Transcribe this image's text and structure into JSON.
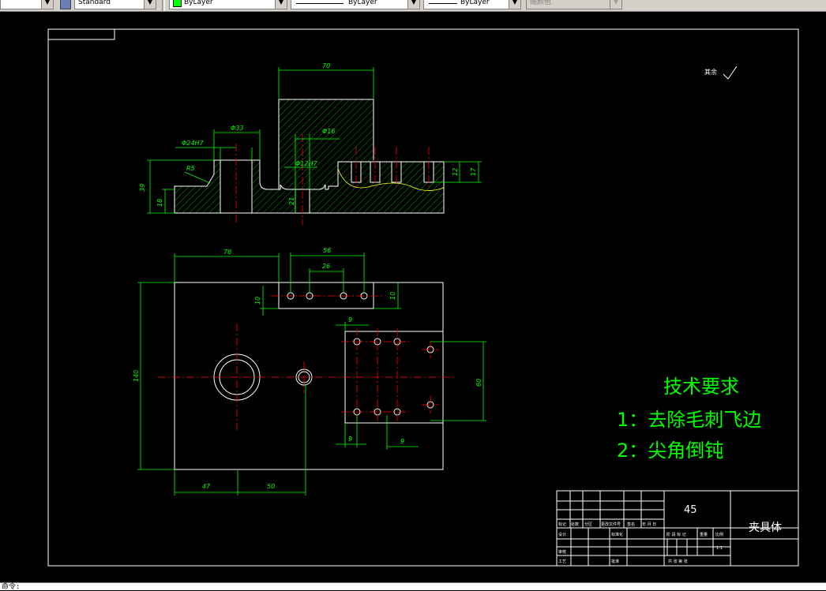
{
  "toolbar": {
    "textstyle": "Standard",
    "layer": "ByLayer",
    "linetype": "ByLayer",
    "lineweight": "ByLayer",
    "plotstyle": "随颜色"
  },
  "drawing": {
    "dims": {
      "d70": "70",
      "d33": "Φ33",
      "d24": "Φ24H7",
      "d16": "Φ16",
      "d12h7": "Φ12H7",
      "r5": "R5",
      "d39": "39",
      "d18": "18",
      "d21": "21",
      "d12": "12",
      "d17": "17",
      "d78": "78",
      "d56": "56",
      "d26": "26",
      "d10a": "10",
      "d10b": "10",
      "d140": "140",
      "d60": "60",
      "d9a": "9",
      "d9b": "9",
      "d9c": "9",
      "d47": "47",
      "d50": "50"
    },
    "roughness": "其余",
    "notes": {
      "title": "技术要求",
      "item1": "1：去除毛刺飞边",
      "item2": "2：尖角倒钝"
    },
    "titleblock": {
      "material": "45",
      "part_name": "夹具体",
      "row_mark": "标记",
      "row_qty": "处数",
      "row_zone": "分区",
      "row_docno": "更改文件号",
      "row_sign": "签名",
      "row_date": "年 月 日",
      "design": "设计",
      "standardize": "标准化",
      "check": "审核",
      "process": "工艺",
      "approve": "批准",
      "stage_label": "阶 段 标 记",
      "weight_label": "重量",
      "scale_label": "比例",
      "scale": "1:1",
      "sheets": "共    张  第    张"
    }
  },
  "command_line": "命令:"
}
